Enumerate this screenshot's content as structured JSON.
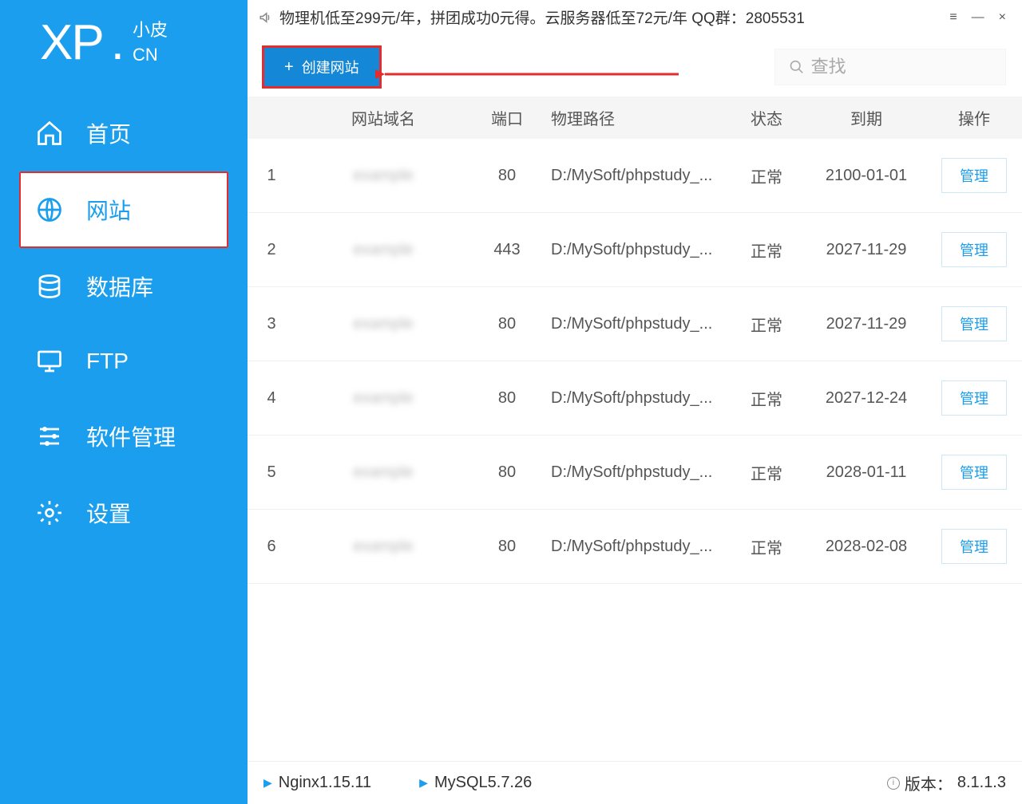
{
  "logo": {
    "main": "XP",
    "dot": ".",
    "sub1": "小皮",
    "sub2": "CN"
  },
  "sidebar": {
    "items": [
      {
        "label": "首页"
      },
      {
        "label": "网站"
      },
      {
        "label": "数据库"
      },
      {
        "label": "FTP"
      },
      {
        "label": "软件管理"
      },
      {
        "label": "设置"
      }
    ]
  },
  "topbar": {
    "announcement": "物理机低至299元/年，拼团成功0元得。云服务器低至72元/年  QQ群：2805531"
  },
  "toolbar": {
    "create_label": "创建网站",
    "search_placeholder": "查找"
  },
  "table": {
    "headers": {
      "domain": "网站域名",
      "port": "端口",
      "path": "物理路径",
      "status": "状态",
      "expire": "到期",
      "action": "操作"
    },
    "manage_label": "管理",
    "rows": [
      {
        "idx": "1",
        "domain": "",
        "port": "80",
        "path": "D:/MySoft/phpstudy_...",
        "status": "正常",
        "expire": "2100-01-01"
      },
      {
        "idx": "2",
        "domain": "",
        "port": "443",
        "path": "D:/MySoft/phpstudy_...",
        "status": "正常",
        "expire": "2027-11-29"
      },
      {
        "idx": "3",
        "domain": "",
        "port": "80",
        "path": "D:/MySoft/phpstudy_...",
        "status": "正常",
        "expire": "2027-11-29"
      },
      {
        "idx": "4",
        "domain": "",
        "port": "80",
        "path": "D:/MySoft/phpstudy_...",
        "status": "正常",
        "expire": "2027-12-24"
      },
      {
        "idx": "5",
        "domain": "",
        "port": "80",
        "path": "D:/MySoft/phpstudy_...",
        "status": "正常",
        "expire": "2028-01-11"
      },
      {
        "idx": "6",
        "domain": "",
        "port": "80",
        "path": "D:/MySoft/phpstudy_...",
        "status": "正常",
        "expire": "2028-02-08"
      }
    ]
  },
  "statusbar": {
    "services": [
      {
        "label": "Nginx1.15.11"
      },
      {
        "label": "MySQL5.7.26"
      }
    ],
    "version_prefix": "版本：",
    "version": "8.1.1.3"
  }
}
